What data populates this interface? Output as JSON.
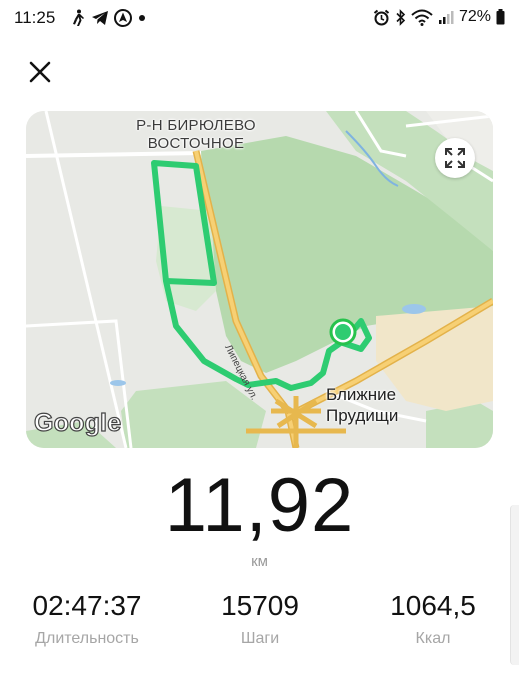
{
  "status_bar": {
    "time": "11:25",
    "battery": "72%"
  },
  "map": {
    "district_label": "Р-Н БИРЮЛЕВО ВОСТОЧНОЕ",
    "place_label": "Ближние Прудищи",
    "street_label": "Липецкая ул.",
    "provider_logo": "Google"
  },
  "workout": {
    "distance": "11,92",
    "distance_unit": "км",
    "duration": "02:47:37",
    "duration_label": "Длительность",
    "steps": "15709",
    "steps_label": "Шаги",
    "calories": "1064,5",
    "calories_label": "Ккал"
  },
  "icons": {
    "close": "close-icon",
    "fullscreen": "fullscreen-icon",
    "walk": "walk-icon",
    "telegram": "telegram-icon",
    "navigation": "navigation-icon",
    "alarm": "alarm-icon",
    "bluetooth": "bluetooth-icon",
    "wifi": "wifi-icon",
    "signal": "signal-icon",
    "battery": "battery-icon"
  },
  "colors": {
    "route": "#2ecc71",
    "route_marker": "#27c24c",
    "forest": "#b9dcb2",
    "highway": "#f4c35a"
  }
}
